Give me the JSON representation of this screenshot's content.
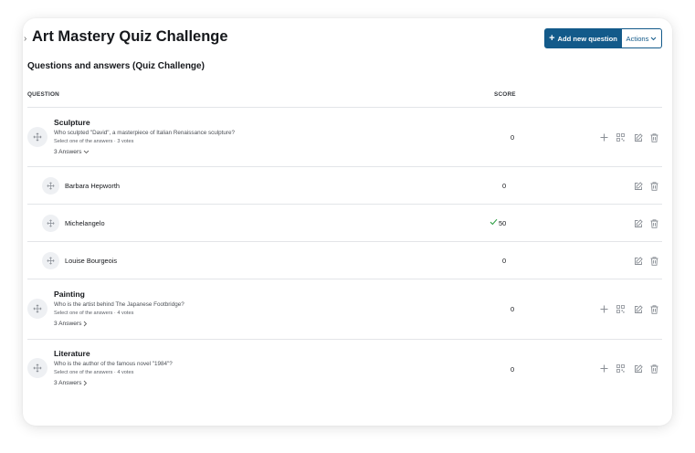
{
  "header": {
    "title": "Art Mastery Quiz Challenge",
    "add_button_label": "Add new question",
    "actions_label": "Actions"
  },
  "section_title": "Questions and answers (Quiz Challenge)",
  "columns": {
    "question": "QUESTION",
    "score": "SCORE"
  },
  "questions": [
    {
      "title": "Sculpture",
      "text": "Who sculpted \"David\", a masterpiece of Italian Renaissance sculpture?",
      "meta": "Select one of the answers · 3 votes",
      "answers_label": "3 Answers",
      "score": "0",
      "expanded": true
    },
    {
      "title": "Painting",
      "text": "Who is the artist behind The Japanese Footbridge?",
      "meta": "Select one of the answers · 4 votes",
      "answers_label": "3 Answers",
      "score": "0",
      "expanded": false
    },
    {
      "title": "Literature",
      "text": "Who is the author of the famous novel \"1984\"?",
      "meta": "Select one of the answers · 4 votes",
      "answers_label": "3 Answers",
      "score": "0",
      "expanded": false
    }
  ],
  "answers": [
    {
      "label": "Barbara Hepworth",
      "score": "0",
      "correct": false
    },
    {
      "label": "Michelangelo",
      "score": "50",
      "correct": true
    },
    {
      "label": "Louise Bourgeois",
      "score": "0",
      "correct": false
    }
  ],
  "colors": {
    "primary": "#135a8a",
    "correct": "#2f9e44",
    "icon": "#8a8f96"
  },
  "icons": [
    "drag-handle-icon",
    "plus-icon",
    "qr-code-icon",
    "edit-icon",
    "trash-icon",
    "chevron-down-icon",
    "chevron-right-icon",
    "check-icon"
  ]
}
